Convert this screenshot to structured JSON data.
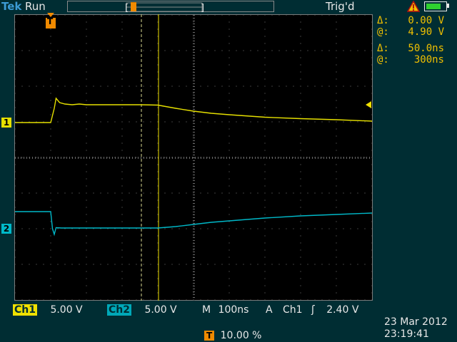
{
  "header": {
    "brand": "Tek",
    "acq_state": "Run",
    "trigger_status": "Trig'd"
  },
  "cursor_readout": {
    "amp_delta_symbol": "Δ:",
    "amp_delta": "0.00 V",
    "amp_at_symbol": "@:",
    "amp_at": "4.90 V",
    "time_delta_symbol": "Δ:",
    "time_delta": "50.0ns",
    "time_at_symbol": "@:",
    "time_at": "300ns"
  },
  "channels": {
    "ch1": {
      "label": "Ch1",
      "scale": "5.00 V",
      "marker": "1",
      "color": "#e6e000"
    },
    "ch2": {
      "label": "Ch2",
      "scale": "5.00 V",
      "marker": "2",
      "color": "#00b8c8"
    }
  },
  "timebase": {
    "label": "M",
    "value": "100ns"
  },
  "trigger": {
    "mode": "A",
    "source": "Ch1",
    "slope_symbol": "ʃ",
    "level": "2.40 V",
    "marker": "T"
  },
  "trigger_position": {
    "marker": "T",
    "value": "10.00 %"
  },
  "timestamp": {
    "date": "23 Mar  2012",
    "time": "23:19:41"
  },
  "chart_data": {
    "type": "line",
    "x_unit": "ns",
    "xlim": [
      0,
      1000
    ],
    "series": [
      {
        "name": "Ch1",
        "x": [
          0,
          100,
          110,
          115,
          125,
          140,
          160,
          180,
          200,
          250,
          300,
          350,
          400,
          450,
          500,
          550,
          600,
          700,
          800,
          900,
          1000
        ],
        "y": [
          0.0,
          0.0,
          2.0,
          3.4,
          2.8,
          2.6,
          2.5,
          2.6,
          2.5,
          2.5,
          2.5,
          2.5,
          2.45,
          2.0,
          1.6,
          1.3,
          1.1,
          0.75,
          0.55,
          0.4,
          0.2
        ]
      },
      {
        "name": "Ch2",
        "x": [
          0,
          100,
          105,
          110,
          115,
          130,
          200,
          300,
          350,
          400,
          450,
          500,
          550,
          600,
          700,
          800,
          900,
          1000
        ],
        "y": [
          2.4,
          2.4,
          0.0,
          -0.8,
          0.15,
          0.1,
          0.1,
          0.1,
          0.1,
          0.1,
          0.3,
          0.6,
          0.9,
          1.1,
          1.5,
          1.8,
          2.0,
          2.2
        ]
      }
    ]
  }
}
